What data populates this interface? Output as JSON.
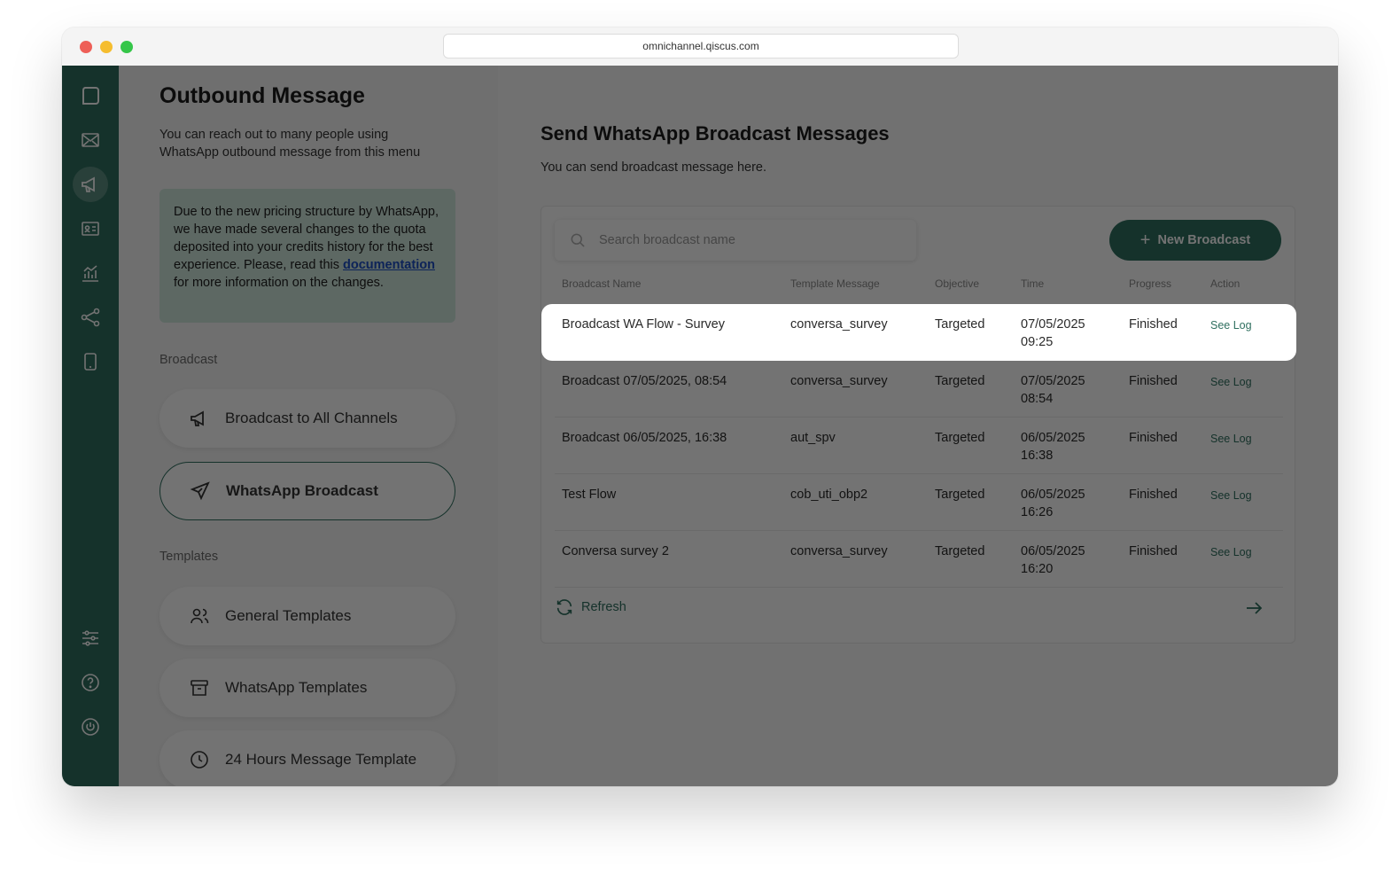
{
  "browser": {
    "url": "omnichannel.qiscus.com"
  },
  "sidebar": {
    "top_icons": [
      "qiscus-logo-icon",
      "inbox-icon",
      "megaphone-icon",
      "contact-card-icon",
      "analytics-icon",
      "integration-icon",
      "mobile-icon"
    ],
    "bottom_icons": [
      "settings-sliders-icon",
      "help-icon",
      "power-icon"
    ],
    "active": "megaphone-icon",
    "color": "#2f6f5f"
  },
  "left": {
    "title": "Outbound Message",
    "description": "You can reach out to many people using WhatsApp outbound message from this menu",
    "notice": {
      "before": "Due to the new pricing structure by WhatsApp, we have made several changes to the quota deposited into your credits history for the best experience. Please, read this ",
      "link": "documentation",
      "after": " for more information on the changes."
    },
    "broadcast_label": "Broadcast",
    "broadcast_items": [
      {
        "label": "Broadcast to All Channels",
        "icon": "megaphone-icon"
      },
      {
        "label": "WhatsApp Broadcast",
        "icon": "send-icon",
        "active": true
      }
    ],
    "templates_label": "Templates",
    "template_items": [
      {
        "label": "General Templates",
        "icon": "users-icon"
      },
      {
        "label": "WhatsApp Templates",
        "icon": "archive-icon"
      },
      {
        "label": "24 Hours Message Template",
        "icon": "clock-icon"
      }
    ]
  },
  "main": {
    "title": "Send WhatsApp Broadcast Messages",
    "description": "You can send broadcast message here.",
    "search_placeholder": "Search broadcast name",
    "new_button": "New Broadcast",
    "columns": [
      "Broadcast Name",
      "Template Message",
      "Objective",
      "Time",
      "Progress",
      "Action"
    ],
    "rows": [
      {
        "name": "Broadcast WA Flow - Survey",
        "template": "conversa_survey",
        "objective": "Targeted",
        "date": "07/05/2025",
        "time": "09:25",
        "progress": "Finished",
        "action": "See Log"
      },
      {
        "name": "Broadcast 07/05/2025, 08:54",
        "template": "conversa_survey",
        "objective": "Targeted",
        "date": "07/05/2025",
        "time": "08:54",
        "progress": "Finished",
        "action": "See Log"
      },
      {
        "name": "Broadcast 06/05/2025, 16:38",
        "template": "aut_spv",
        "objective": "Targeted",
        "date": "06/05/2025",
        "time": "16:38",
        "progress": "Finished",
        "action": "See Log"
      },
      {
        "name": "Test Flow",
        "template": "cob_uti_obp2",
        "objective": "Targeted",
        "date": "06/05/2025",
        "time": "16:26",
        "progress": "Finished",
        "action": "See Log"
      },
      {
        "name": "Conversa survey 2",
        "template": "conversa_survey",
        "objective": "Targeted",
        "date": "06/05/2025",
        "time": "16:20",
        "progress": "Finished",
        "action": "See Log"
      }
    ],
    "refresh": "Refresh",
    "accent": "#2f6f5f"
  }
}
